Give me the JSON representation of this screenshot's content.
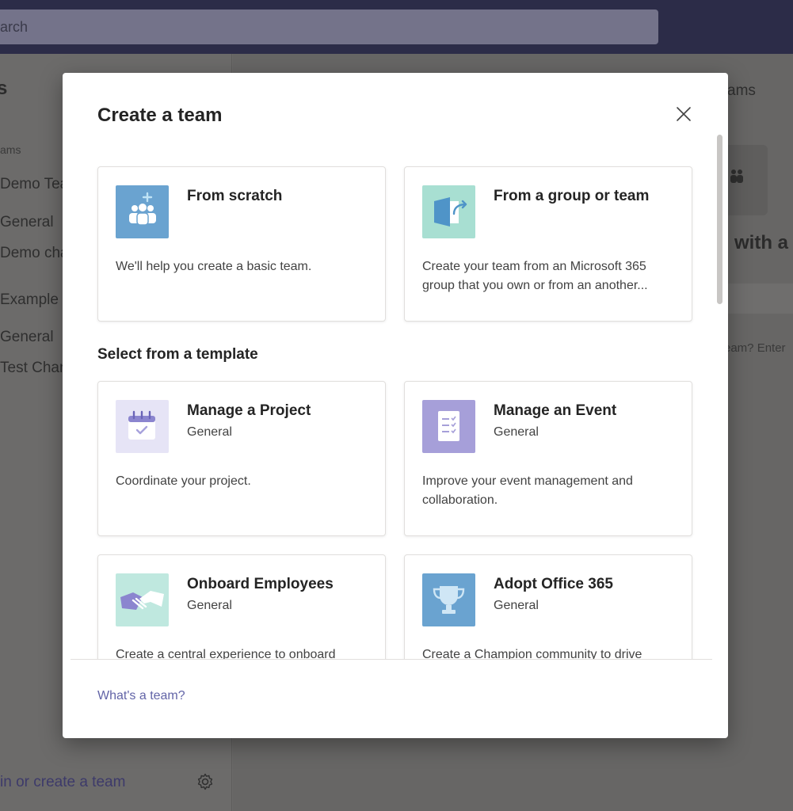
{
  "background": {
    "search_text": "arch",
    "left": {
      "header": "s",
      "section_label": "ams",
      "team1": "Demo Tea",
      "team1_channel1": "General",
      "team1_channel2": "Demo cha",
      "team2": "Example T",
      "team2_channel1": "General",
      "team2_channel2": "Test Chan",
      "join_create": "in or create a team"
    },
    "main": {
      "teams_tab": "ams",
      "headline": "with a",
      "hint": "eam? Enter"
    }
  },
  "dialog": {
    "title": "Create a team",
    "close_label": "Close",
    "top_cards": [
      {
        "title": "From scratch",
        "description": "We'll help you create a basic team.",
        "icon": "people-add-icon",
        "color": "#6aa3d0"
      },
      {
        "title": "From a group or team",
        "description": "Create your team from an Microsoft 365 group that you own or from an another...",
        "icon": "group-arrow-icon",
        "color": "#a8dfd2"
      }
    ],
    "template_section_title": "Select from a template",
    "templates": [
      {
        "title": "Manage a Project",
        "subtitle": "General",
        "description": "Coordinate your project.",
        "icon": "calendar-check-icon",
        "color": "#e6e4f6"
      },
      {
        "title": "Manage an Event",
        "subtitle": "General",
        "description": "Improve your event management and collaboration.",
        "icon": "checklist-icon",
        "color": "#a69fd9"
      },
      {
        "title": "Onboard Employees",
        "subtitle": "General",
        "description": "Create a central experience to onboard",
        "icon": "handshake-icon",
        "color": "#bfe8df"
      },
      {
        "title": "Adopt Office 365",
        "subtitle": "General",
        "description": "Create a Champion community to drive",
        "icon": "trophy-icon",
        "color": "#6aa3d0"
      }
    ],
    "footer_link": "What's a team?"
  }
}
